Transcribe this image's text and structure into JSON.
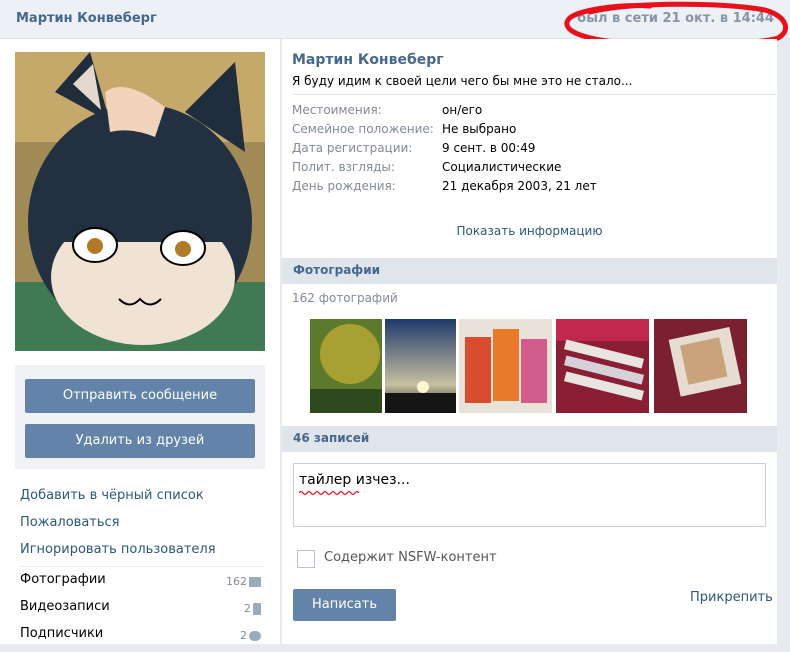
{
  "header": {
    "name": "Мартин Конвеберг",
    "online_status": "был в сети 21 окт. в 14:44"
  },
  "profile": {
    "name": "Мартин Конвеберг",
    "status": "Я буду идим к своей цели чего бы мне это не стало...",
    "info": [
      {
        "label": "Местоимения:",
        "value": "он/его"
      },
      {
        "label": "Семейное положение:",
        "value": "Не выбрано"
      },
      {
        "label": "Дата регистрации:",
        "value": "9 сент. в 00:49"
      },
      {
        "label": "Полит. взгляды:",
        "value": "Социалистические"
      },
      {
        "label": "День рождения:",
        "value": "21 декабря 2003, 21 лет"
      }
    ],
    "show_info_link": "Показать информацию"
  },
  "actions": {
    "send_message": "Отправить сообщение",
    "remove_friend": "Удалить из друзей"
  },
  "side_links": [
    {
      "label": "Добавить в чёрный список"
    },
    {
      "label": "Пожаловаться"
    },
    {
      "label": "Игнорировать пользователя"
    },
    {
      "label": "Фотографии",
      "count": "162",
      "icon": "camera-icon"
    },
    {
      "label": "Видеозаписи",
      "count": "2",
      "icon": "film-icon"
    },
    {
      "label": "Подписчики",
      "count": "2",
      "icon": "people-icon"
    }
  ],
  "photos": {
    "section_title": "Фотографии",
    "count_text": "162 фотографий"
  },
  "wall": {
    "section_title": "46 записей",
    "post_text": "тайлер изчез...",
    "nsfw_label": "Содержит NSFW-контент",
    "submit_label": "Написать",
    "attach_label": "Прикрепить"
  },
  "colors": {
    "accent": "#45688e",
    "button": "#6383a8",
    "annotation": "#e8111b"
  }
}
